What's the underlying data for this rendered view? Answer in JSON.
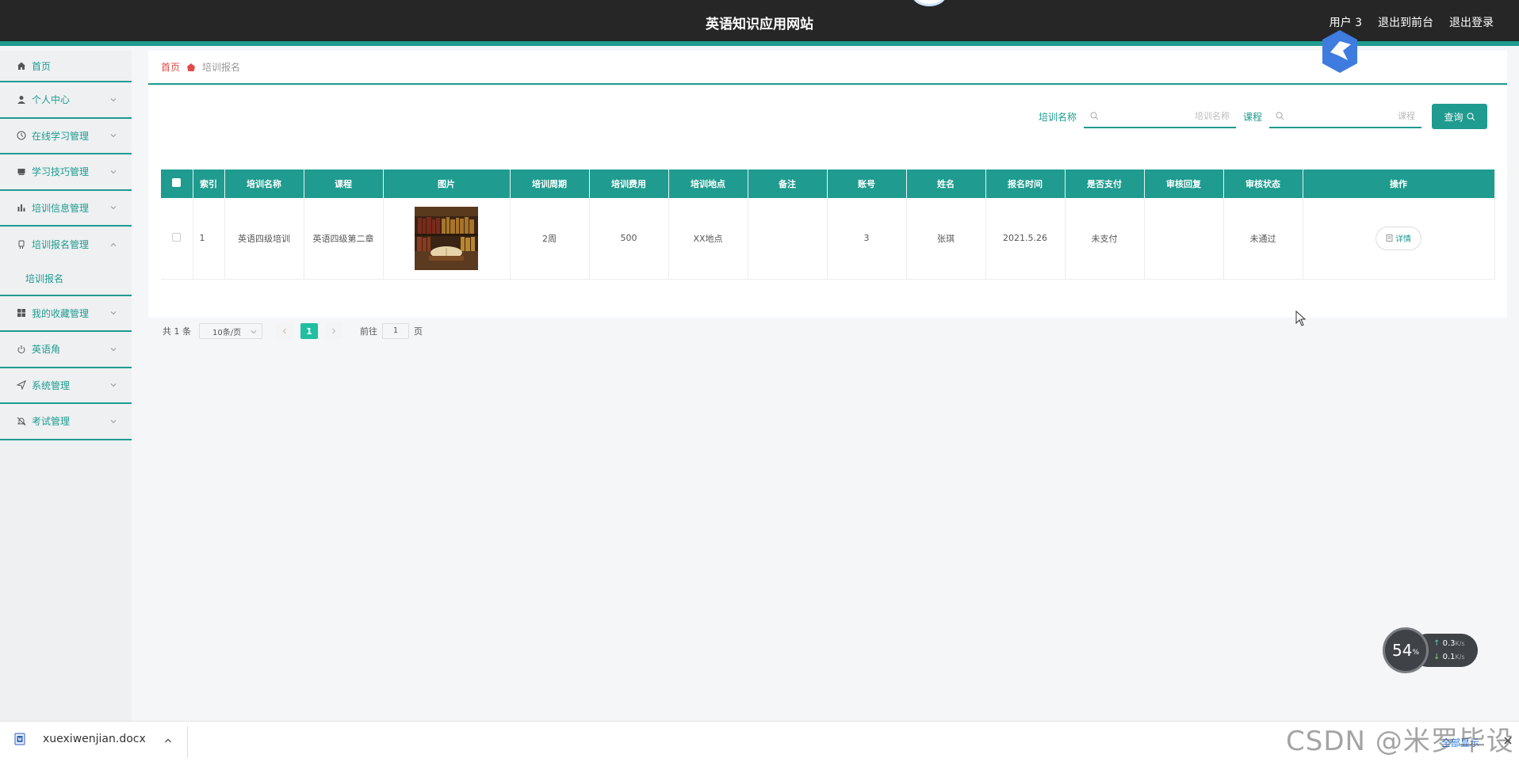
{
  "header": {
    "title": "英语知识应用网站",
    "user_label": "用户 3",
    "front_link": "退出到前台",
    "logout_link": "退出登录"
  },
  "sidebar": {
    "items": [
      {
        "label": "首页",
        "icon": "home-icon"
      },
      {
        "label": "个人中心",
        "icon": "user-icon"
      },
      {
        "label": "在线学习管理",
        "icon": "clock-icon"
      },
      {
        "label": "学习技巧管理",
        "icon": "book-icon"
      },
      {
        "label": "培训信息管理",
        "icon": "bar-chart-icon"
      },
      {
        "label": "培训报名管理",
        "icon": "badge-icon"
      },
      {
        "label": "我的收藏管理",
        "icon": "grid-icon"
      },
      {
        "label": "英语角",
        "icon": "power-icon"
      },
      {
        "label": "系统管理",
        "icon": "send-icon"
      },
      {
        "label": "考试管理",
        "icon": "bell-off-icon"
      }
    ],
    "submenu_label": "培训报名"
  },
  "breadcrumb": {
    "home": "首页",
    "current": "培训报名"
  },
  "search": {
    "name_label": "培训名称",
    "name_placeholder": "培训名称",
    "course_label": "课程",
    "course_placeholder": "课程",
    "query_label": "查询"
  },
  "table": {
    "headers": [
      "索引",
      "培训名称",
      "课程",
      "图片",
      "培训周期",
      "培训费用",
      "培训地点",
      "备注",
      "账号",
      "姓名",
      "报名时间",
      "是否支付",
      "审核回复",
      "审核状态",
      "操作"
    ],
    "rows": [
      {
        "index": "1",
        "name": "英语四级培训",
        "course": "英语四级第二章",
        "period": "2周",
        "fee": "500",
        "location": "XX地点",
        "remark": "",
        "account": "3",
        "person": "张琪",
        "signup_time": "2021.5.26",
        "paid": "未支付",
        "reply": "",
        "status": "未通过",
        "action": "详情"
      }
    ]
  },
  "pager": {
    "total": "共 1 条",
    "page_size": "10条/页",
    "current_page": "1",
    "goto_prefix": "前往",
    "goto_value": "1",
    "goto_suffix": "页"
  },
  "speed_widget": {
    "percent": "54",
    "percent_unit": "%",
    "upload": "0.3",
    "download": "0.1",
    "unit": "K/s"
  },
  "download_bar": {
    "filename": "xuexiwenjian.docx",
    "show_all": "全部显示"
  },
  "watermark": "CSDN @米罗毕设",
  "colors": {
    "accent": "#1f9b8f",
    "header_bg": "#262626",
    "page_active": "#1fbfa0"
  }
}
